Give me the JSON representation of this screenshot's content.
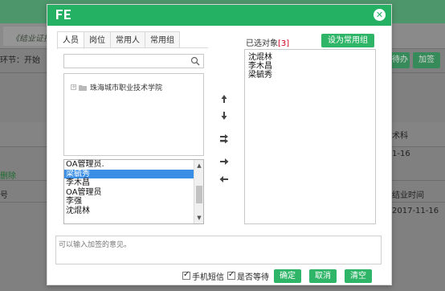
{
  "background": {
    "tab_title": "《结业证换",
    "node_label": "环节：开始",
    "delete_link": "删除",
    "col_fragment": "号",
    "dept_fragment": "术科",
    "date_fragment": "1-16",
    "header_time": "结业时间",
    "row_date": "2017-11-16",
    "btn_pending": "待办",
    "btn_countersign": "加签"
  },
  "dialog": {
    "close_icon": "close-icon",
    "tabs": [
      "人员",
      "岗位",
      "常用人",
      "常用组"
    ],
    "search_placeholder": "",
    "tree_root": "珠海城市职业技术学院",
    "candidates": [
      "OA管理员.",
      "梁毓秀",
      "李木昌",
      "OA管理员",
      "李强",
      "沈焜林"
    ],
    "selected_candidate_index": 1,
    "arrows": {
      "up": "🠕",
      "down": "🠗",
      "add_all": "⇶",
      "add": "➜",
      "remove": "⬅"
    },
    "selected_label": "已选对象",
    "selected_count": "[3]",
    "set_common_group": "设为常用组",
    "selected_people": [
      "沈焜林",
      "李木昌",
      "梁毓秀"
    ],
    "opinion_placeholder": "可以输入加签的意见。",
    "footer": {
      "sms_label": "手机短信",
      "wait_label": "是否等待",
      "confirm": "确定",
      "cancel": "取消",
      "clear": "清空"
    }
  },
  "colors": {
    "accent": "#25b163",
    "button": "#2eb567",
    "selection": "#3a8ee6",
    "count": "#d0021b"
  }
}
